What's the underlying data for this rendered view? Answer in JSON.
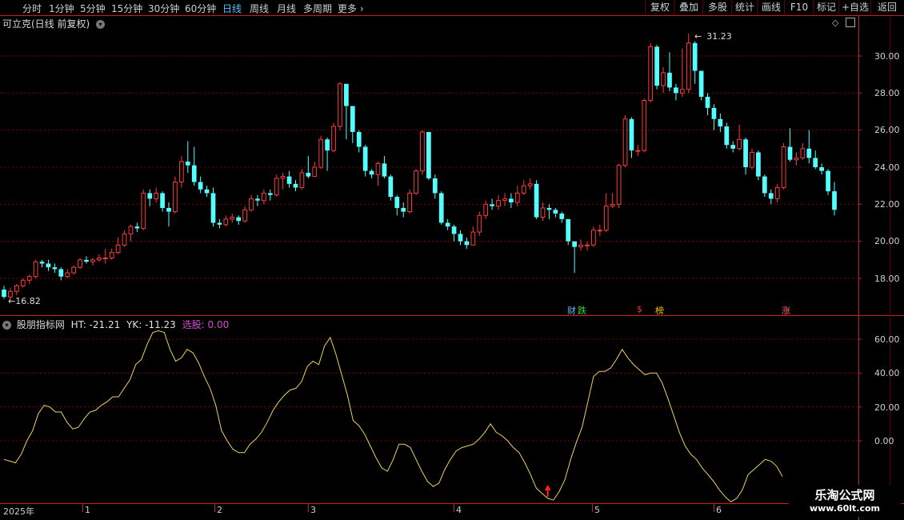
{
  "toolbar": {
    "periods": [
      "分时",
      "1分钟",
      "5分钟",
      "15分钟",
      "30分钟",
      "60分钟",
      "日线",
      "周线",
      "月线",
      "多周期",
      "更多"
    ],
    "active_period": "日线",
    "right_buttons": [
      "复权",
      "叠加",
      "多股",
      "统计",
      "画线",
      "F10",
      "标记",
      "+自选",
      "返回"
    ]
  },
  "main_panel": {
    "title": "可立克(日线 前复权)",
    "y_ticks": [
      "30.00",
      "28.00",
      "26.00",
      "24.00",
      "22.00",
      "20.00",
      "18.00"
    ],
    "high_label": "31.23",
    "low_label": "16.82",
    "markers": [
      {
        "text": "财",
        "color": "#4fc3ff"
      },
      {
        "text": "跌",
        "color": "#33dd33"
      },
      {
        "text": "$",
        "color": "#ff3030"
      },
      {
        "text": "榜",
        "color": "#f0c000"
      },
      {
        "text": "涨",
        "color": "#ff6060"
      }
    ]
  },
  "indicator_panel": {
    "name": "股朋指标网",
    "ht_text": "HT: -21.21",
    "yk_text": "YK: -11.23",
    "xg_text": "选股: 0.00",
    "y_ticks": [
      "60.00",
      "40.00",
      "20.00",
      "0.00"
    ]
  },
  "x_axis": [
    "2025年",
    "1",
    "2",
    "3",
    "4",
    "5",
    "6"
  ],
  "watermark": {
    "line1": "乐淘公式网",
    "line2": "www.60lt.com"
  },
  "chart_data": [
    {
      "type": "candlestick",
      "ylim": [
        16.3,
        31.9
      ],
      "y_ticks": [
        18,
        20,
        22,
        24,
        26,
        28,
        30
      ],
      "candles": [
        [
          17.4,
          17.0,
          17.6,
          16.9
        ],
        [
          17.0,
          17.3,
          17.5,
          16.8
        ],
        [
          17.3,
          17.6,
          17.7,
          17.1
        ],
        [
          17.6,
          17.9,
          18.0,
          17.5
        ],
        [
          17.9,
          18.1,
          18.2,
          17.7
        ],
        [
          18.1,
          18.9,
          19.0,
          18.0
        ],
        [
          18.9,
          18.8,
          19.0,
          18.6
        ],
        [
          18.8,
          18.6,
          19.0,
          18.4
        ],
        [
          18.6,
          18.5,
          18.8,
          18.3
        ],
        [
          18.5,
          18.1,
          18.6,
          17.9
        ],
        [
          18.1,
          18.3,
          18.5,
          18.0
        ],
        [
          18.3,
          18.6,
          18.7,
          18.2
        ],
        [
          18.6,
          19.0,
          19.1,
          18.5
        ],
        [
          19.0,
          18.9,
          19.2,
          18.8
        ],
        [
          18.9,
          19.0,
          19.1,
          18.7
        ],
        [
          19.0,
          19.1,
          19.3,
          18.9
        ],
        [
          19.1,
          19.1,
          19.6,
          18.8
        ],
        [
          19.1,
          19.4,
          19.6,
          19.0
        ],
        [
          19.4,
          19.8,
          20.2,
          19.3
        ],
        [
          19.8,
          20.4,
          20.6,
          19.7
        ],
        [
          20.4,
          20.8,
          20.9,
          20.0
        ],
        [
          20.8,
          20.7,
          21.0,
          20.5
        ],
        [
          20.7,
          22.6,
          22.8,
          20.6
        ],
        [
          22.6,
          22.3,
          22.8,
          21.9
        ],
        [
          22.3,
          22.6,
          22.9,
          22.1
        ],
        [
          22.6,
          21.8,
          22.7,
          21.6
        ],
        [
          21.8,
          21.6,
          22.1,
          20.8
        ],
        [
          21.6,
          23.2,
          23.5,
          21.5
        ],
        [
          23.2,
          24.3,
          24.6,
          22.9
        ],
        [
          24.3,
          24.1,
          25.4,
          23.7
        ],
        [
          24.1,
          23.2,
          25.1,
          23.0
        ],
        [
          23.2,
          22.8,
          23.5,
          22.6
        ],
        [
          22.8,
          22.6,
          23.0,
          22.4
        ],
        [
          22.6,
          21.0,
          22.9,
          20.8
        ],
        [
          21.0,
          20.9,
          21.2,
          20.7
        ],
        [
          20.9,
          21.2,
          21.4,
          20.8
        ],
        [
          21.2,
          21.3,
          21.5,
          21.0
        ],
        [
          21.3,
          21.1,
          21.4,
          20.9
        ],
        [
          21.1,
          21.7,
          21.9,
          21.0
        ],
        [
          21.7,
          22.3,
          22.5,
          21.6
        ],
        [
          22.3,
          22.2,
          22.5,
          21.9
        ],
        [
          22.2,
          22.6,
          22.8,
          22.0
        ],
        [
          22.6,
          22.5,
          22.8,
          22.2
        ],
        [
          22.5,
          23.4,
          23.6,
          22.4
        ],
        [
          23.4,
          23.5,
          23.7,
          22.8
        ],
        [
          23.5,
          23.1,
          23.8,
          22.9
        ],
        [
          23.1,
          22.9,
          23.3,
          22.7
        ],
        [
          22.9,
          23.7,
          23.9,
          22.8
        ],
        [
          23.7,
          23.5,
          24.6,
          23.4
        ],
        [
          23.5,
          24.0,
          24.3,
          23.6
        ],
        [
          24.0,
          25.5,
          25.7,
          23.9
        ],
        [
          25.5,
          24.9,
          25.6,
          23.8
        ],
        [
          24.9,
          26.2,
          26.4,
          24.8
        ],
        [
          26.2,
          28.5,
          28.6,
          26.0
        ],
        [
          28.5,
          27.3,
          28.2,
          25.5
        ],
        [
          27.3,
          25.9,
          26.4,
          25.3
        ],
        [
          25.9,
          25.1,
          26.0,
          24.8
        ],
        [
          25.1,
          23.8,
          25.2,
          23.5
        ],
        [
          23.8,
          23.6,
          23.9,
          23.4
        ],
        [
          23.6,
          24.2,
          24.3,
          23.0
        ],
        [
          24.2,
          23.5,
          24.6,
          23.4
        ],
        [
          23.5,
          22.4,
          23.6,
          22.2
        ],
        [
          22.4,
          21.8,
          22.5,
          21.4
        ],
        [
          21.8,
          21.6,
          22.1,
          21.3
        ],
        [
          21.6,
          22.6,
          22.8,
          21.5
        ],
        [
          22.6,
          23.8,
          23.9,
          22.5
        ],
        [
          23.8,
          25.9,
          26.0,
          23.6
        ],
        [
          25.9,
          23.4,
          25.3,
          23.3
        ],
        [
          23.4,
          22.6,
          23.6,
          22.3
        ],
        [
          22.6,
          21.0,
          22.7,
          20.9
        ],
        [
          21.0,
          20.8,
          21.2,
          20.6
        ],
        [
          20.8,
          20.4,
          20.9,
          20.0
        ],
        [
          20.4,
          20.0,
          20.6,
          19.8
        ],
        [
          20.0,
          19.8,
          20.2,
          19.6
        ],
        [
          19.8,
          20.5,
          20.8,
          19.8
        ],
        [
          20.5,
          21.4,
          21.6,
          20.3
        ],
        [
          21.4,
          22.0,
          22.2,
          21.2
        ],
        [
          22.0,
          21.9,
          22.3,
          21.7
        ],
        [
          21.9,
          22.2,
          22.5,
          21.7
        ],
        [
          22.2,
          22.3,
          22.6,
          21.9
        ],
        [
          22.3,
          22.1,
          22.6,
          21.8
        ],
        [
          22.1,
          22.6,
          23.0,
          21.9
        ],
        [
          22.6,
          23.0,
          23.3,
          22.5
        ],
        [
          23.0,
          23.1,
          23.4,
          22.8
        ],
        [
          23.1,
          21.3,
          23.3,
          21.2
        ],
        [
          21.3,
          21.8,
          22.1,
          21.1
        ],
        [
          21.8,
          21.7,
          22.0,
          21.2
        ],
        [
          21.7,
          21.5,
          21.8,
          21.3
        ],
        [
          21.5,
          21.2,
          21.6,
          21.0
        ],
        [
          21.2,
          20.0,
          20.8,
          19.8
        ],
        [
          20.0,
          19.7,
          20.0,
          18.3
        ],
        [
          19.7,
          19.8,
          20.1,
          19.5
        ],
        [
          19.8,
          19.8,
          20.0,
          19.5
        ],
        [
          19.8,
          20.6,
          20.8,
          19.7
        ],
        [
          20.6,
          20.6,
          20.9,
          20.3
        ],
        [
          20.6,
          21.9,
          22.6,
          20.5
        ],
        [
          21.9,
          22.0,
          22.6,
          21.8
        ],
        [
          22.0,
          24.1,
          24.2,
          21.8
        ],
        [
          24.1,
          26.6,
          26.8,
          24.0
        ],
        [
          26.6,
          24.9,
          26.7,
          24.5
        ],
        [
          24.9,
          24.9,
          25.2,
          24.6
        ],
        [
          24.9,
          27.6,
          27.7,
          24.8
        ],
        [
          27.6,
          30.5,
          30.7,
          27.5
        ],
        [
          30.5,
          28.4,
          30.6,
          28.2
        ],
        [
          28.4,
          29.1,
          29.4,
          28.0
        ],
        [
          29.1,
          28.3,
          30.2,
          28.1
        ],
        [
          28.3,
          28.0,
          28.5,
          27.6
        ],
        [
          28.0,
          28.2,
          30.4,
          27.8
        ],
        [
          28.2,
          30.7,
          31.2,
          28.0
        ],
        [
          30.7,
          29.2,
          30.8,
          28.5
        ],
        [
          29.2,
          27.8,
          29.2,
          27.6
        ],
        [
          27.8,
          27.2,
          28.0,
          26.8
        ],
        [
          27.2,
          26.6,
          27.4,
          26.0
        ],
        [
          26.6,
          26.2,
          26.9,
          25.9
        ],
        [
          26.2,
          25.2,
          26.4,
          25.0
        ],
        [
          25.2,
          25.0,
          25.4,
          24.8
        ],
        [
          25.0,
          25.5,
          26.3,
          24.9
        ],
        [
          25.5,
          24.0,
          25.6,
          23.6
        ],
        [
          24.0,
          24.8,
          25.0,
          23.9
        ],
        [
          24.8,
          23.5,
          24.9,
          23.3
        ],
        [
          23.5,
          22.6,
          23.6,
          22.4
        ],
        [
          22.6,
          22.3,
          22.8,
          22.0
        ],
        [
          22.3,
          22.9,
          23.1,
          22.1
        ],
        [
          22.9,
          25.1,
          25.3,
          22.8
        ],
        [
          25.1,
          24.4,
          26.1,
          24.3
        ],
        [
          24.4,
          24.5,
          24.8,
          24.1
        ],
        [
          24.5,
          25.0,
          25.3,
          24.4
        ],
        [
          25.0,
          24.5,
          26.0,
          24.2
        ],
        [
          24.5,
          24.0,
          24.9,
          23.9
        ],
        [
          24.0,
          23.8,
          24.2,
          23.6
        ],
        [
          23.8,
          22.7,
          23.9,
          22.5
        ],
        [
          22.7,
          21.7,
          23.2,
          21.4
        ]
      ]
    },
    {
      "type": "line",
      "ylim": [
        -37,
        68
      ],
      "y_ticks": [
        60,
        40,
        20,
        0
      ],
      "series": [
        {
          "values": [
            -11,
            -12,
            -13,
            -8,
            0,
            6,
            16,
            21,
            20,
            17,
            17,
            11,
            7,
            8,
            13,
            17,
            18,
            21,
            23,
            26,
            26,
            31,
            36,
            45,
            48,
            57,
            64,
            65,
            64,
            54,
            47,
            49,
            54,
            52,
            46,
            38,
            31,
            21,
            6,
            0,
            -5,
            -7,
            -7,
            -2,
            1,
            5,
            11,
            18,
            23,
            27,
            30,
            31,
            35,
            44,
            47,
            45,
            56,
            61,
            51,
            39,
            27,
            12,
            9,
            4,
            -3,
            -10,
            -16,
            -18,
            -11,
            -2,
            -2,
            -4,
            -11,
            -18,
            -24,
            -27,
            -25,
            -17,
            -11,
            -6,
            -4,
            -3,
            -2,
            1,
            5,
            10,
            5,
            3,
            0,
            -4,
            -7,
            -13,
            -20,
            -28,
            -31,
            -34,
            -35,
            -30,
            -23,
            -11,
            -1,
            8,
            23,
            38,
            41,
            41,
            43,
            48,
            54,
            49,
            45,
            42,
            39,
            40,
            40,
            34,
            25,
            15,
            5,
            -3,
            -8,
            -11,
            -16,
            -20,
            -24,
            -29,
            -33,
            -36,
            -34,
            -29,
            -20,
            -17,
            -14,
            -11,
            -12,
            -15,
            -21
          ]
        }
      ],
      "signal": {
        "index": 95,
        "color": "#ff2020"
      }
    }
  ]
}
